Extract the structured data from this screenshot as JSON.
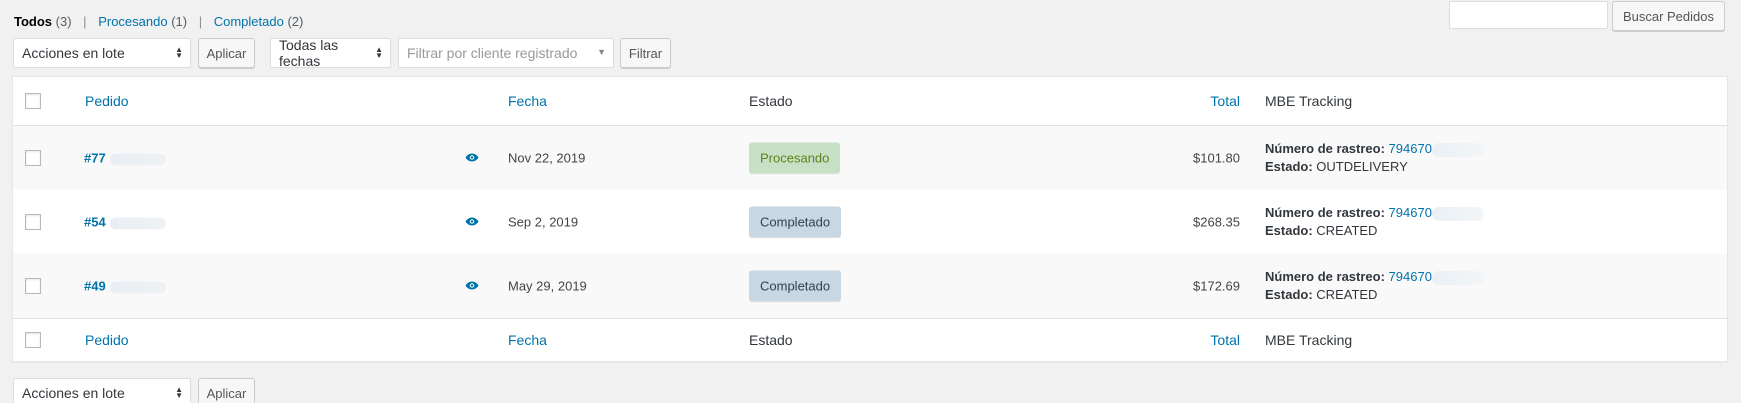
{
  "views": {
    "all": {
      "label": "Todos",
      "count": "(3)"
    },
    "processing": {
      "label": "Procesando",
      "count": "(1)"
    },
    "completed": {
      "label": "Completado",
      "count": "(2)"
    },
    "separator": "|"
  },
  "search": {
    "input_value": "",
    "button": "Buscar Pedidos"
  },
  "toolbar_top": {
    "bulk_actions": "Acciones en lote",
    "apply": "Aplicar",
    "dates": "Todas las fechas",
    "customer_placeholder": "Filtrar por cliente registrado",
    "filter": "Filtrar"
  },
  "columns": {
    "order": "Pedido",
    "date": "Fecha",
    "status": "Estado",
    "total": "Total",
    "tracking": "MBE Tracking"
  },
  "orders": [
    {
      "number": "#77",
      "date": "Nov 22, 2019",
      "status": "Procesando",
      "total": "$101.80",
      "tracking_label": "Número de rastreo:",
      "tracking_number": "794670",
      "state_label": "Estado:",
      "state": "OUTDELIVERY"
    },
    {
      "number": "#54",
      "date": "Sep 2, 2019",
      "status": "Completado",
      "total": "$268.35",
      "tracking_label": "Número de rastreo:",
      "tracking_number": "794670",
      "state_label": "Estado:",
      "state": "CREATED"
    },
    {
      "number": "#49",
      "date": "May 29, 2019",
      "status": "Completado",
      "total": "$172.69",
      "tracking_label": "Número de rastreo:",
      "tracking_number": "794670",
      "state_label": "Estado:",
      "state": "CREATED"
    }
  ],
  "toolbar_bottom": {
    "bulk_actions": "Acciones en lote",
    "apply": "Aplicar"
  },
  "icons": {
    "preview": "eye-icon",
    "select_arrows": "up-down-arrows-icon",
    "dropdown": "caret-down-icon"
  },
  "colors": {
    "link": "#0073aa",
    "processing_bg": "#c6e1c6",
    "processing_text": "#5b841b",
    "completed_bg": "#c8d7e1",
    "completed_text": "#2e4453"
  }
}
